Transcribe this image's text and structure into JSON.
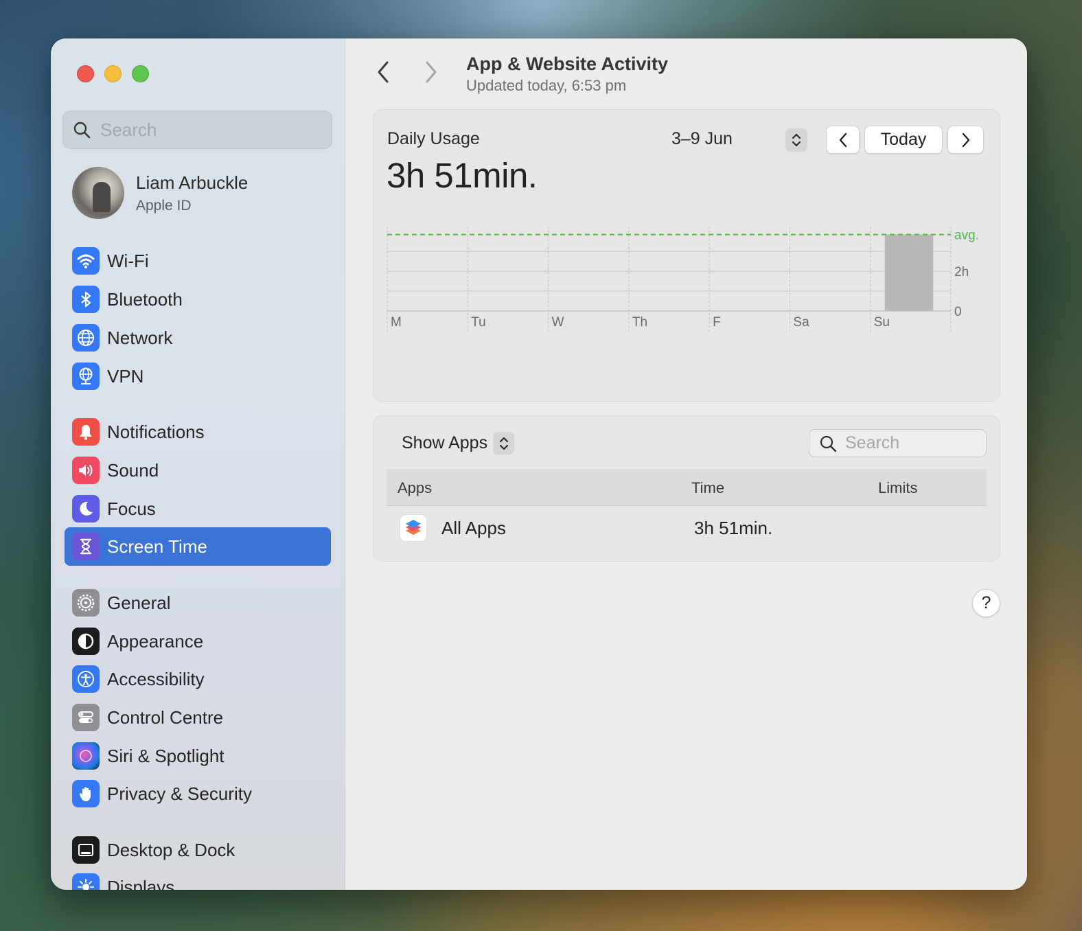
{
  "sidebar": {
    "search_placeholder": "Search",
    "profile": {
      "name": "Liam Arbuckle",
      "subtitle": "Apple ID"
    },
    "items": [
      {
        "label": "Wi-Fi",
        "icon": "wifi-icon",
        "color": "#3478f6"
      },
      {
        "label": "Bluetooth",
        "icon": "bluetooth-icon",
        "color": "#3478f6"
      },
      {
        "label": "Network",
        "icon": "globe-icon",
        "color": "#3478f6"
      },
      {
        "label": "VPN",
        "icon": "vpn-globe-icon",
        "color": "#3478f6"
      },
      {
        "label": "Notifications",
        "icon": "bell-icon",
        "color": "#ef4f45"
      },
      {
        "label": "Sound",
        "icon": "speaker-icon",
        "color": "#ee4b62"
      },
      {
        "label": "Focus",
        "icon": "moon-icon",
        "color": "#5e5ce6"
      },
      {
        "label": "Screen Time",
        "icon": "hourglass-icon",
        "color": "#6a55d6",
        "active": true
      },
      {
        "label": "General",
        "icon": "gear-icon",
        "color": "#8e8e93"
      },
      {
        "label": "Appearance",
        "icon": "appearance-icon",
        "color": "#1c1c1e"
      },
      {
        "label": "Accessibility",
        "icon": "accessibility-icon",
        "color": "#3478f6"
      },
      {
        "label": "Control Centre",
        "icon": "toggles-icon",
        "color": "#8e8e93"
      },
      {
        "label": "Siri & Spotlight",
        "icon": "siri-icon",
        "color": "#2a2a44"
      },
      {
        "label": "Privacy & Security",
        "icon": "hand-icon",
        "color": "#3478f6"
      },
      {
        "label": "Desktop & Dock",
        "icon": "dock-icon",
        "color": "#1c1c1e"
      },
      {
        "label": "Displays",
        "icon": "sun-icon",
        "color": "#3478f6"
      }
    ]
  },
  "header": {
    "title": "App & Website Activity",
    "subtitle": "Updated today, 6:53 pm"
  },
  "usage": {
    "label": "Daily Usage",
    "value": "3h 51min.",
    "range": "3–9 Jun",
    "today_label": "Today"
  },
  "chart_data": {
    "type": "bar",
    "categories": [
      "M",
      "Tu",
      "W",
      "Th",
      "F",
      "Sa",
      "Su"
    ],
    "values": [
      0,
      0,
      0,
      0,
      0,
      0,
      3.85
    ],
    "y_tick_labels": [
      "0",
      "2h"
    ],
    "avg_label": "avg.",
    "avg_value": 3.85,
    "ylim": [
      0,
      4.25
    ],
    "grid": true,
    "bar_color": "#b9b9bb",
    "avg_color": "#4fb84a"
  },
  "apps": {
    "show_label": "Show Apps",
    "search_placeholder": "Search",
    "columns": [
      "Apps",
      "Time",
      "Limits"
    ],
    "rows": [
      {
        "name": "All Apps",
        "time": "3h 51min.",
        "icon": "stack-icon"
      }
    ]
  },
  "help_label": "?"
}
